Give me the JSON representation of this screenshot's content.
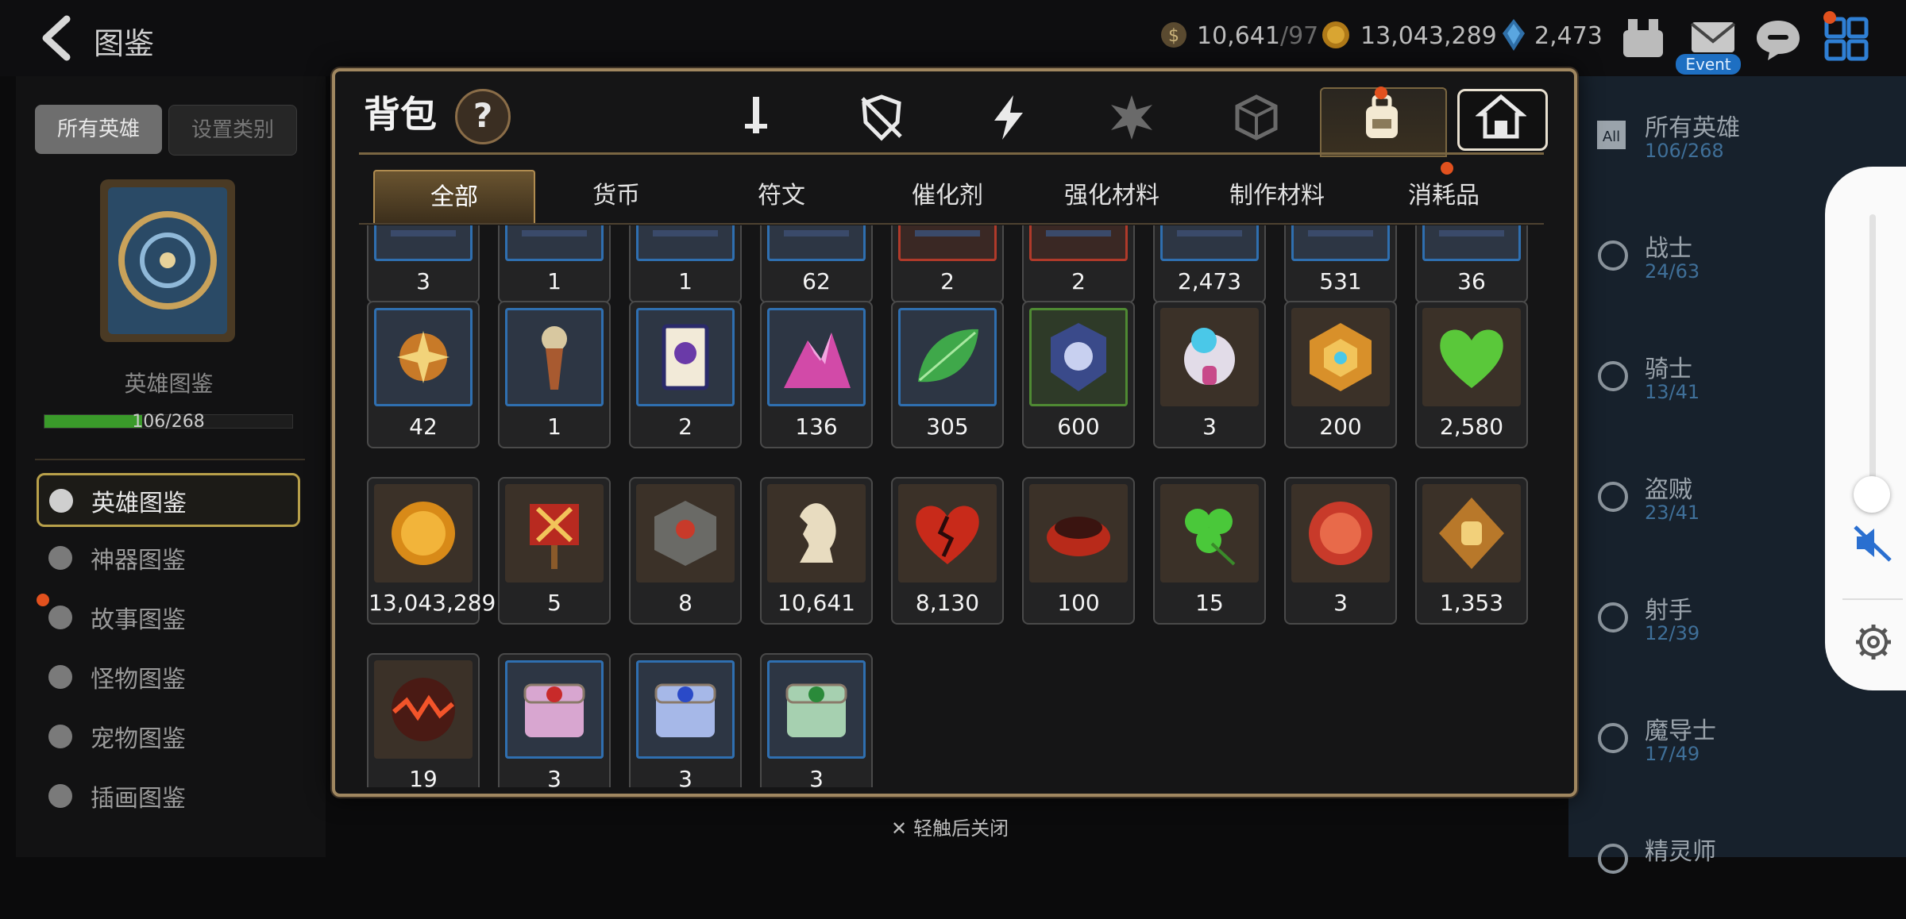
{
  "topbar": {
    "title": "图鉴",
    "stamina": "10,641",
    "stamina_max": "/97",
    "gold": "13,043,289",
    "crystals": "2,473",
    "event_label": "Event"
  },
  "left": {
    "tab_all_heroes": "所有英雄",
    "tab_category": "设置类别",
    "book_label": "英雄图鉴",
    "book_count": "106/268",
    "book_progress": 0.395,
    "menu": [
      "英雄图鉴",
      "神器图鉴",
      "故事图鉴",
      "怪物图鉴",
      "宠物图鉴",
      "插画图鉴"
    ]
  },
  "right": {
    "all_icon_text": "All",
    "classes": [
      {
        "name": "所有英雄",
        "count": "106/268"
      },
      {
        "name": "战士",
        "count": "24/63"
      },
      {
        "name": "骑士",
        "count": "13/41"
      },
      {
        "name": "盗贼",
        "count": "23/41"
      },
      {
        "name": "射手",
        "count": "12/39"
      },
      {
        "name": "魔导士",
        "count": "17/49"
      },
      {
        "name": "精灵师",
        "count": ""
      }
    ]
  },
  "bag": {
    "title": "背包",
    "help": "?",
    "categories": [
      "weapon-icon",
      "shield-off-icon",
      "lightning-icon",
      "burst-icon",
      "dice-icon",
      "backpack-icon",
      "house-icon"
    ],
    "sub_tabs": [
      "全部",
      "货币",
      "符文",
      "催化剂",
      "强化材料",
      "制作材料",
      "消耗品"
    ],
    "rows": [
      [
        {
          "qty": "3",
          "icon": "partial",
          "frame": "blue"
        },
        {
          "qty": "1",
          "icon": "partial",
          "frame": "blue"
        },
        {
          "qty": "1",
          "icon": "partial",
          "frame": "blue"
        },
        {
          "qty": "62",
          "icon": "partial",
          "frame": "blue"
        },
        {
          "qty": "2",
          "icon": "partial",
          "frame": "red"
        },
        {
          "qty": "2",
          "icon": "partial",
          "frame": "red"
        },
        {
          "qty": "2,473",
          "icon": "partial",
          "frame": "blue"
        },
        {
          "qty": "531",
          "icon": "partial",
          "frame": "blue"
        },
        {
          "qty": "36",
          "icon": "partial",
          "frame": "blue"
        }
      ],
      [
        {
          "qty": "42",
          "icon": "star-amulet-icon",
          "frame": "blue"
        },
        {
          "qty": "1",
          "icon": "ornament-icon",
          "frame": "blue"
        },
        {
          "qty": "2",
          "icon": "card-icon",
          "frame": "blue"
        },
        {
          "qty": "136",
          "icon": "crystal-mountain-icon",
          "frame": "blue"
        },
        {
          "qty": "305",
          "icon": "leaf-icon",
          "frame": "blue"
        },
        {
          "qty": "600",
          "icon": "emblem-icon",
          "frame": "green"
        },
        {
          "qty": "3",
          "icon": "robot-icon",
          "frame": ""
        },
        {
          "qty": "200",
          "icon": "gold-crest-icon",
          "frame": ""
        },
        {
          "qty": "2,580",
          "icon": "heart-icon",
          "frame": ""
        }
      ],
      [
        {
          "qty": "13,043,289",
          "icon": "gold-coin-icon",
          "frame": ""
        },
        {
          "qty": "5",
          "icon": "banner-icon",
          "frame": ""
        },
        {
          "qty": "8",
          "icon": "stone-cube-icon",
          "frame": ""
        },
        {
          "qty": "10,641",
          "icon": "knight-piece-icon",
          "frame": ""
        },
        {
          "qty": "8,130",
          "icon": "broken-heart-icon",
          "frame": ""
        },
        {
          "qty": "100",
          "icon": "ring-icon",
          "frame": ""
        },
        {
          "qty": "15",
          "icon": "clover-icon",
          "frame": ""
        },
        {
          "qty": "3",
          "icon": "badge-icon",
          "frame": ""
        },
        {
          "qty": "1,353",
          "icon": "fist-crest-icon",
          "frame": ""
        }
      ],
      [
        {
          "qty": "19",
          "icon": "lava-orb-icon",
          "frame": ""
        },
        {
          "qty": "3",
          "icon": "pink-chest-icon",
          "frame": "blue"
        },
        {
          "qty": "3",
          "icon": "blue-chest-icon",
          "frame": "blue"
        },
        {
          "qty": "3",
          "icon": "green-chest-icon",
          "frame": "blue"
        }
      ]
    ],
    "close_hint": "轻触后关闭"
  }
}
